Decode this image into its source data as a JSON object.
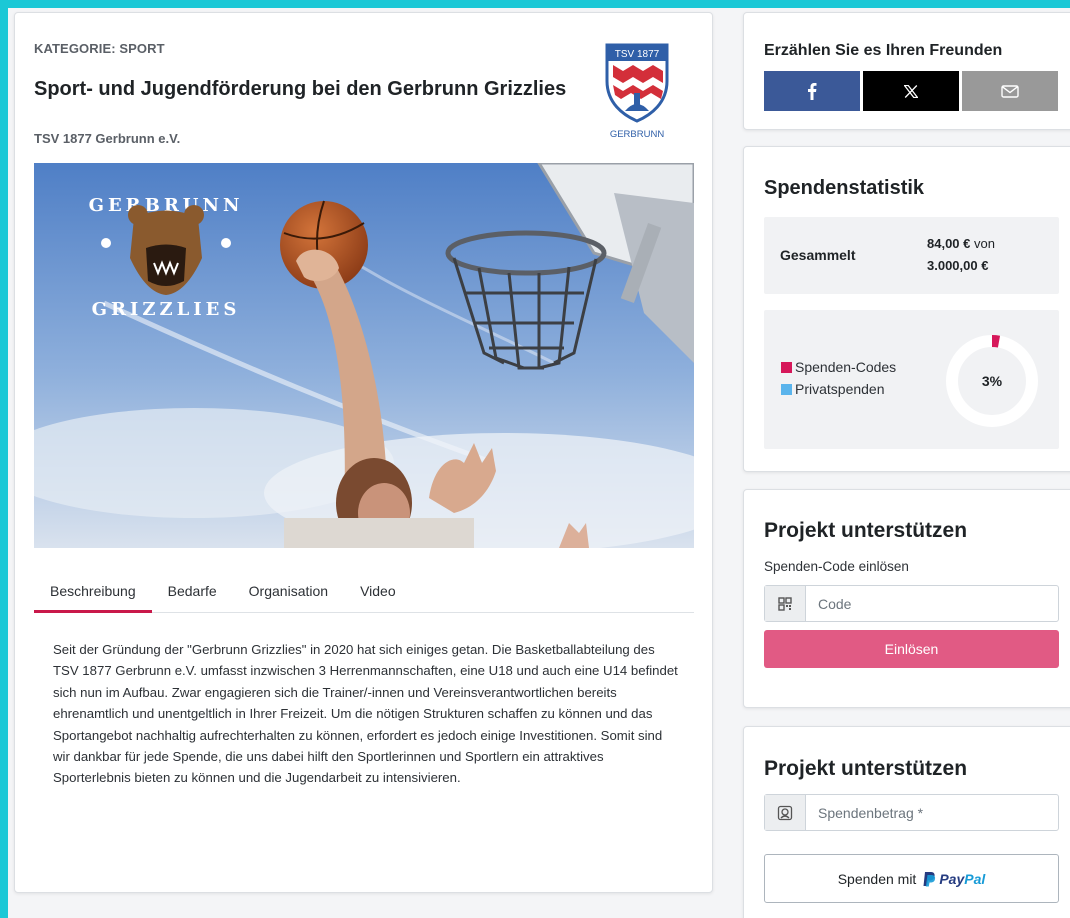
{
  "project": {
    "category": "KATEGORIE: SPORT",
    "title": "Sport- und Jugendförderung bei den Gerbrunn Grizzlies",
    "organization": "TSV 1877 Gerbrunn e.V.",
    "logo_top_text": "TSV 1877",
    "logo_bottom_text": "GERBRUNN",
    "hero_logo_top": "GERBRUNN",
    "hero_logo_bottom": "GRIZZLIES"
  },
  "tabs": [
    {
      "label": "Beschreibung",
      "active": true
    },
    {
      "label": "Bedarfe",
      "active": false
    },
    {
      "label": "Organisation",
      "active": false
    },
    {
      "label": "Video",
      "active": false
    }
  ],
  "description": "Seit der Gründung der \"Gerbrunn Grizzlies\" in 2020 hat sich einiges getan. Die Basketballabteilung des TSV 1877 Gerbrunn e.V. umfasst inzwischen 3 Herrenmannschaften, eine U18 und auch eine U14 befindet sich nun im Aufbau. Zwar engagieren sich die Trainer/-innen und Vereinsverantwortlichen bereits ehrenamtlich und unentgeltlich in Ihrer Freizeit. Um die nötigen Strukturen schaffen zu können und das Sportangebot nachhaltig aufrechterhalten zu können, erfordert es jedoch einige Investitionen. Somit sind wir dankbar für jede Spende, die uns dabei hilft den Sportlerinnen und Sportlern ein attraktives Sporterlebnis bieten zu können und die Jugendarbeit zu intensivieren.",
  "share": {
    "title": "Erzählen Sie es Ihren Freunden",
    "buttons": [
      {
        "icon": "facebook-icon",
        "color": "#3b5998"
      },
      {
        "icon": "x-icon",
        "color": "#000000"
      },
      {
        "icon": "mail-icon",
        "color": "#999999"
      }
    ]
  },
  "stats": {
    "title": "Spendenstatistik",
    "collected_label": "Gesammelt",
    "collected_amount": "84,00 €",
    "von": "von",
    "goal_amount": "3.000,00 €",
    "percent_label": "3%",
    "percent_value": 0.028,
    "legend": [
      {
        "label": "Spenden-Codes",
        "color": "#d6185a"
      },
      {
        "label": "Privatspenden",
        "color": "#5ab4ec"
      }
    ]
  },
  "redeem": {
    "title": "Projekt unterstützen",
    "field_label": "Spenden-Code einlösen",
    "placeholder": "Code",
    "button_label": "Einlösen",
    "button_color": "#e15a84"
  },
  "donate": {
    "title": "Projekt unterstützen",
    "placeholder": "Spendenbetrag *",
    "button_label": "Spenden mit",
    "paypal_pay": "Pay",
    "paypal_pal": "Pal"
  }
}
